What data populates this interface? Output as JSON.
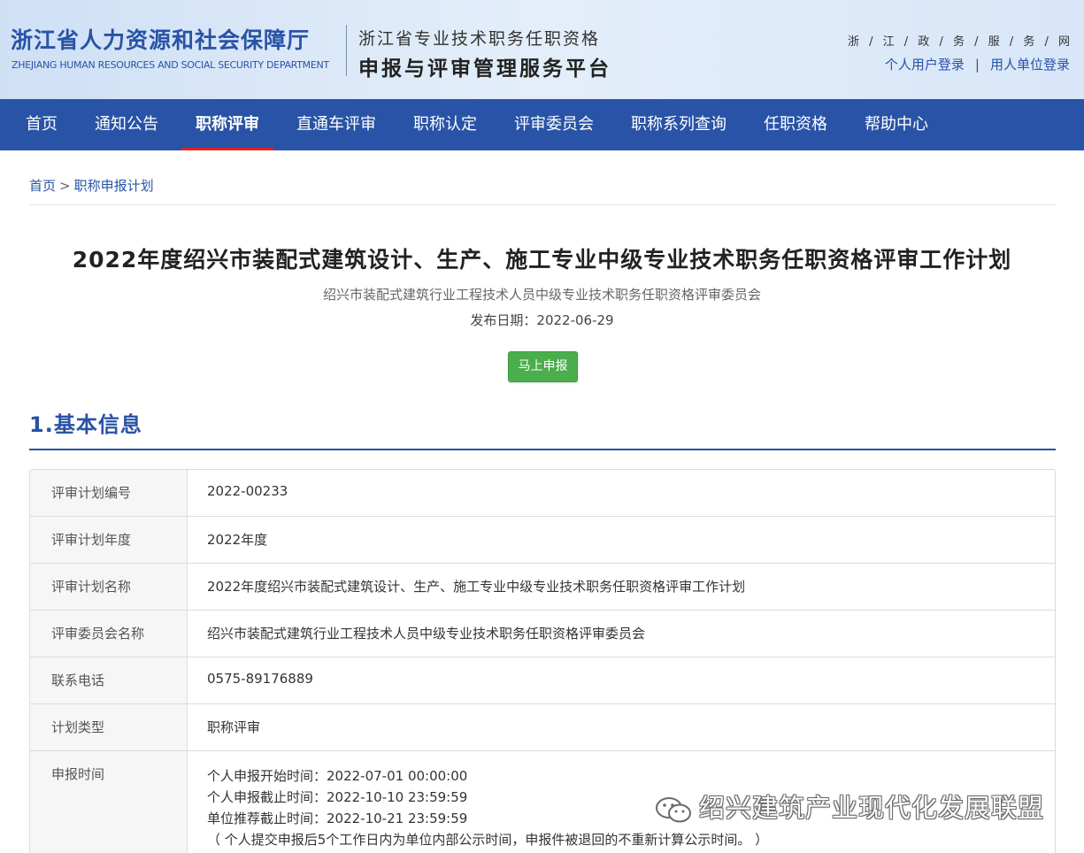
{
  "header": {
    "dept_cn": "浙江省人力资源和社会保障厅",
    "dept_en": "ZHEJIANG HUMAN RESOURCES AND SOCIAL SECURITY DEPARTMENT",
    "platform_line1": "浙江省专业技术职务任职资格",
    "platform_line2": "申报与评审管理服务平台",
    "gov_chars": [
      "浙",
      "江",
      "政",
      "务",
      "服",
      "务",
      "网"
    ],
    "login_personal": "个人用户登录",
    "login_separator": "|",
    "login_unit": "用人单位登录"
  },
  "nav": {
    "items": [
      "首页",
      "通知公告",
      "职称评审",
      "直通车评审",
      "职称认定",
      "评审委员会",
      "职称系列查询",
      "任职资格",
      "帮助中心"
    ],
    "active_index": 2
  },
  "breadcrumb": {
    "home": "首页",
    "arrow": ">",
    "current": "职称申报计划"
  },
  "article": {
    "title": "2022年度绍兴市装配式建筑设计、生产、施工专业中级专业技术职务任职资格评审工作计划",
    "committee": "绍兴市装配式建筑行业工程技术人员中级专业技术职务任职资格评审委员会",
    "pubdate": "发布日期：2022-06-29",
    "apply_button": "马上申报"
  },
  "section": {
    "heading": "1.基本信息"
  },
  "info_rows": [
    {
      "label": "评审计划编号",
      "value": "2022-00233"
    },
    {
      "label": "评审计划年度",
      "value": "2022年度"
    },
    {
      "label": "评审计划名称",
      "value": "2022年度绍兴市装配式建筑设计、生产、施工专业中级专业技术职务任职资格评审工作计划"
    },
    {
      "label": "评审委员会名称",
      "value": "绍兴市装配式建筑行业工程技术人员中级专业技术职务任职资格评审委员会"
    },
    {
      "label": "联系电话",
      "value": "0575-89176889"
    },
    {
      "label": "计划类型",
      "value": "职称评审"
    }
  ],
  "apply_time": {
    "label": "申报时间",
    "lines": [
      "个人申报开始时间：2022-07-01 00:00:00",
      "个人申报截止时间：2022-10-10 23:59:59",
      "单位推荐截止时间：2022-10-21 23:59:59",
      "（ 个人提交申报后5个工作日内为单位内部公示时间，申报件被退回的不重新计算公示时间。 ）"
    ]
  },
  "watermark": {
    "text": "绍兴建筑产业现代化发展联盟",
    "icon": "wechat-icon"
  },
  "colors": {
    "brand_blue": "#2953a6",
    "active_underline": "#e02424",
    "button_green": "#4aae4d"
  }
}
